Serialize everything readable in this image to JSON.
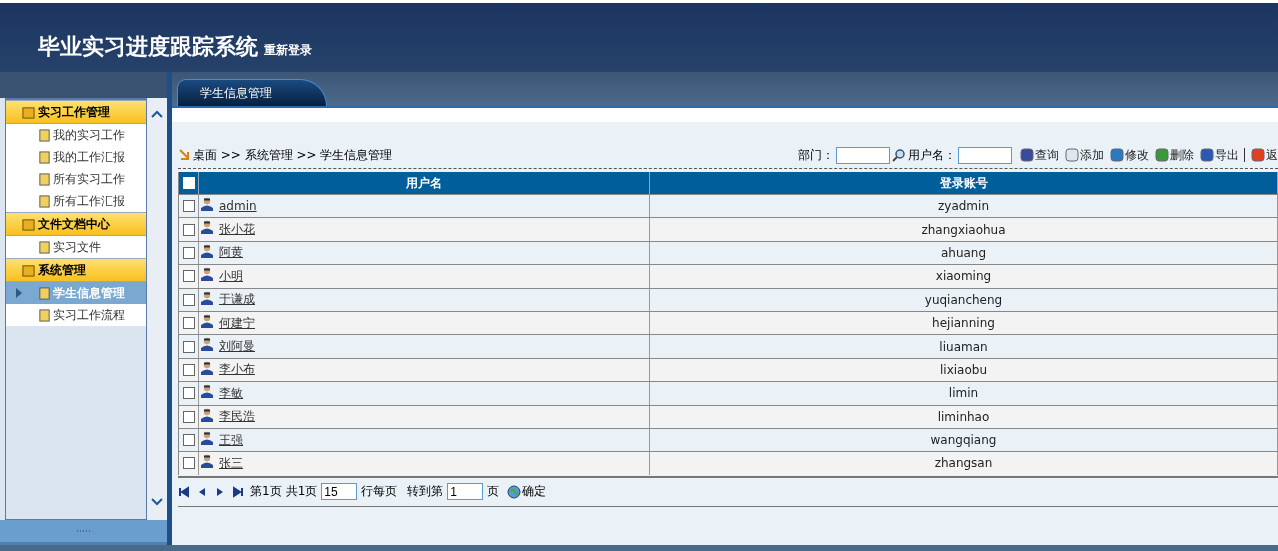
{
  "header": {
    "title": "毕业实习进度跟踪系统",
    "relogin": "重新登录"
  },
  "sidebar": {
    "groups": [
      {
        "label": "实习工作管理",
        "items": [
          {
            "label": "我的实习工作",
            "selected": false
          },
          {
            "label": "我的工作汇报",
            "selected": false
          },
          {
            "label": "所有实习工作",
            "selected": false
          },
          {
            "label": "所有工作汇报",
            "selected": false
          }
        ]
      },
      {
        "label": "文件文档中心",
        "items": [
          {
            "label": "实习文件",
            "selected": false
          }
        ]
      },
      {
        "label": "系统管理",
        "items": [
          {
            "label": "学生信息管理",
            "selected": true
          },
          {
            "label": "实习工作流程",
            "selected": false
          }
        ]
      }
    ]
  },
  "tabs": [
    {
      "label": "学生信息管理",
      "selected": true
    }
  ],
  "breadcrumb": "桌面 >> 系统管理 >> 学生信息管理",
  "filters": [
    {
      "label": "部门："
    },
    {
      "label": "用户名："
    }
  ],
  "actions": [
    "查询",
    "添加",
    "修改",
    "删除",
    "导出",
    "返"
  ],
  "table": {
    "columns": [
      "用户名",
      "登录账号"
    ],
    "all_checked": false,
    "rows": [
      {
        "checked": false,
        "name": "admin",
        "account": "zyadmin"
      },
      {
        "checked": false,
        "name": "张小花",
        "account": "zhangxiaohua"
      },
      {
        "checked": false,
        "name": "阿黄",
        "account": "ahuang"
      },
      {
        "checked": false,
        "name": "小明",
        "account": "xiaoming"
      },
      {
        "checked": false,
        "name": "于谦成",
        "account": "yuqiancheng"
      },
      {
        "checked": false,
        "name": "何建宁",
        "account": "hejianning"
      },
      {
        "checked": false,
        "name": "刘阿曼",
        "account": "liuaman"
      },
      {
        "checked": false,
        "name": "李小布",
        "account": "lixiaobu"
      },
      {
        "checked": false,
        "name": "李敏",
        "account": "limin"
      },
      {
        "checked": false,
        "name": "李民浩",
        "account": "liminhao"
      },
      {
        "checked": false,
        "name": "王强",
        "account": "wangqiang"
      },
      {
        "checked": false,
        "name": "张三",
        "account": "zhangsan"
      }
    ]
  },
  "pagination": {
    "current": "第1页",
    "total": "共1页",
    "page_size": "15",
    "per_page_label": "行每页",
    "goto_label": "转到第",
    "goto_value": "1",
    "page_label": "页",
    "confirm": "确定"
  }
}
